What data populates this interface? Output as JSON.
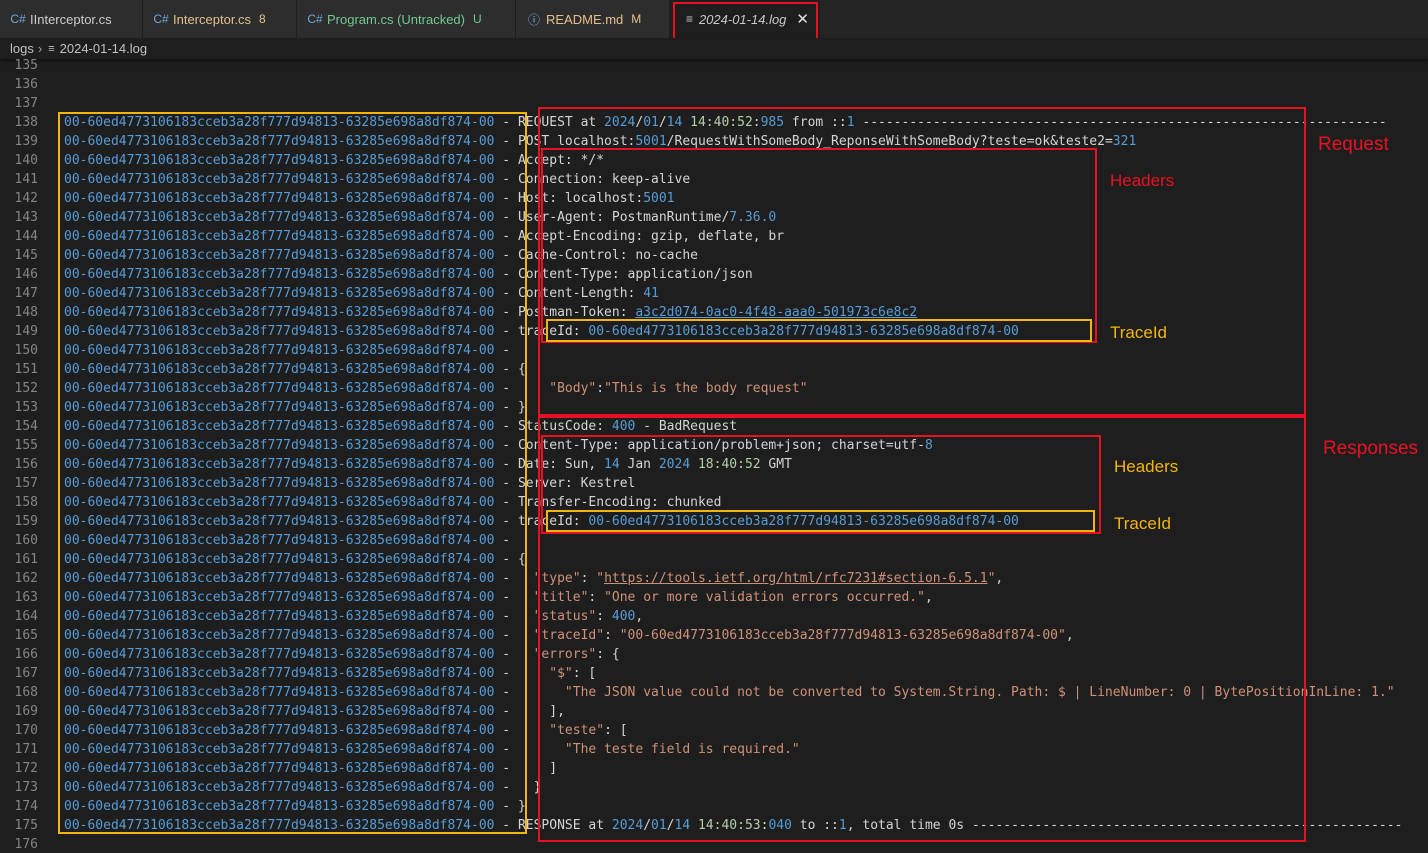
{
  "tabs": [
    {
      "label": "IInterceptor.cs",
      "icon": "C#",
      "color": "#cccccc",
      "badge": "",
      "badge_color": "#cccccc"
    },
    {
      "label": "Interceptor.cs",
      "icon": "C#",
      "color": "#e2c08d",
      "badge": "8",
      "badge_color": "#e2c08d"
    },
    {
      "label": "Program.cs (Untracked)",
      "icon": "C#",
      "color": "#73c991",
      "badge": "U",
      "badge_color": "#73c991"
    },
    {
      "label": "README.md",
      "icon": "ⓘ",
      "color": "#e2c08d",
      "badge": "M",
      "badge_color": "#e2c08d"
    }
  ],
  "active_tab": {
    "label": "2024-01-14.log",
    "icon": "≡",
    "close": "✕"
  },
  "breadcrumb": {
    "folder": "logs",
    "file": "2024-01-14.log",
    "file_icon": "≡"
  },
  "log": {
    "trace_id": "00-60ed4773106183cceb3a28f777d94813-63285e698a8df874-00",
    "first_line": 135
  },
  "lines": [
    {
      "n": "135",
      "tid": false,
      "html": ""
    },
    {
      "n": "136",
      "tid": false,
      "html": ""
    },
    {
      "n": "137",
      "tid": false,
      "html": ""
    },
    {
      "n": "138",
      "tid": true,
      "html": "REQUEST at <span class='num'>2024</span>/<span class='num'>01</span>/<span class='num'>14</span> <span class='gnum'>14:40:52</span>:<span class='num'>985</span> from ::<span class='num'>1</span> -------------------------------------------------------------------"
    },
    {
      "n": "139",
      "tid": true,
      "html": "POST localhost:<span class='num'>5001</span>/RequestWithSomeBody_ReponseWithSomeBody?teste=ok&amp;teste2=<span class='num'>321</span>"
    },
    {
      "n": "140",
      "tid": true,
      "html": "Accept: */*"
    },
    {
      "n": "141",
      "tid": true,
      "html": "Connection: keep-alive"
    },
    {
      "n": "142",
      "tid": true,
      "html": "Host: localhost:<span class='num'>5001</span>"
    },
    {
      "n": "143",
      "tid": true,
      "html": "User-Agent: PostmanRuntime/<span class='num'>7.36.0</span>"
    },
    {
      "n": "144",
      "tid": true,
      "html": "Accept-Encoding: gzip, deflate, br"
    },
    {
      "n": "145",
      "tid": true,
      "html": "Cache-Control: no-cache"
    },
    {
      "n": "146",
      "tid": true,
      "html": "Content-Type: application/json"
    },
    {
      "n": "147",
      "tid": true,
      "html": "Content-Length: <span class='num'>41</span>"
    },
    {
      "n": "148",
      "tid": true,
      "html": "Postman-Token: <span class='num link'>a3c2d074-0ac0-4f48-aaa0-501973c6e8c2</span>"
    },
    {
      "n": "149",
      "tid": true,
      "html": "traceId: <span class='num'>00-60ed4773106183cceb3a28f777d94813-63285e698a8df874-00</span>"
    },
    {
      "n": "150",
      "tid": true,
      "html": ""
    },
    {
      "n": "151",
      "tid": true,
      "html": "{"
    },
    {
      "n": "152",
      "tid": true,
      "html": "    <span class='str'>\"Body\"</span>:<span class='str'>\"This is the body request\"</span>"
    },
    {
      "n": "153",
      "tid": true,
      "html": "}"
    },
    {
      "n": "154",
      "tid": true,
      "html": "StatusCode: <span class='num'>400</span> - BadRequest"
    },
    {
      "n": "155",
      "tid": true,
      "html": "Content-Type: application/problem+json; charset=utf-<span class='num'>8</span>"
    },
    {
      "n": "156",
      "tid": true,
      "html": "Date: Sun, <span class='num'>14</span> Jan <span class='num'>2024</span> <span class='gnum'>18:40:52</span> GMT"
    },
    {
      "n": "157",
      "tid": true,
      "html": "Server: Kestrel"
    },
    {
      "n": "158",
      "tid": true,
      "html": "Transfer-Encoding: chunked"
    },
    {
      "n": "159",
      "tid": true,
      "html": "traceId: <span class='num'>00-60ed4773106183cceb3a28f777d94813-63285e698a8df874-00</span>"
    },
    {
      "n": "160",
      "tid": true,
      "html": ""
    },
    {
      "n": "161",
      "tid": true,
      "html": "{"
    },
    {
      "n": "162",
      "tid": true,
      "html": "  <span class='str'>\"type\"</span>: <span class='str'>\"<span class='link'>https://tools.ietf.org/html/rfc7231#section-6.5.1</span>\"</span>,"
    },
    {
      "n": "163",
      "tid": true,
      "html": "  <span class='str'>\"title\"</span>: <span class='str'>\"One or more validation errors occurred.\"</span>,"
    },
    {
      "n": "164",
      "tid": true,
      "html": "  <span class='str'>\"status\"</span>: <span class='num'>400</span>,"
    },
    {
      "n": "165",
      "tid": true,
      "html": "  <span class='str'>\"traceId\"</span>: <span class='str'>\"00-60ed4773106183cceb3a28f777d94813-63285e698a8df874-00\"</span>,"
    },
    {
      "n": "166",
      "tid": true,
      "html": "  <span class='str'>\"errors\"</span>: {"
    },
    {
      "n": "167",
      "tid": true,
      "html": "    <span class='str'>\"$\"</span>: ["
    },
    {
      "n": "168",
      "tid": true,
      "html": "      <span class='str'>\"The JSON value could not be converted to System.String. Path: $ | LineNumber: 0 | BytePositionInLine: 1.\"</span>"
    },
    {
      "n": "169",
      "tid": true,
      "html": "    ],"
    },
    {
      "n": "170",
      "tid": true,
      "html": "    <span class='str'>\"teste\"</span>: ["
    },
    {
      "n": "171",
      "tid": true,
      "html": "      <span class='str'>\"The teste field is required.\"</span>"
    },
    {
      "n": "172",
      "tid": true,
      "html": "    ]"
    },
    {
      "n": "173",
      "tid": true,
      "html": "  }"
    },
    {
      "n": "174",
      "tid": true,
      "html": "}"
    },
    {
      "n": "175",
      "tid": true,
      "html": "RESPONSE at <span class='num'>2024</span>/<span class='num'>01</span>/<span class='num'>14</span> <span class='gnum'>14:40:53</span>:<span class='num'>040</span> to ::<span class='num'>1</span>, total time 0s -------------------------------------------------------"
    },
    {
      "n": "176",
      "tid": false,
      "html": ""
    }
  ],
  "annotations": {
    "request": "Request",
    "responses": "Responses",
    "headers_request": "Headers",
    "traceid_request": "TraceId",
    "headers_response": "Headers",
    "traceid_response": "TraceId"
  },
  "colors": {
    "annotation_red": "#e81123",
    "annotation_yellow": "#f2b50a",
    "trace_blue": "#569cd6",
    "string_orange": "#ce9178"
  }
}
